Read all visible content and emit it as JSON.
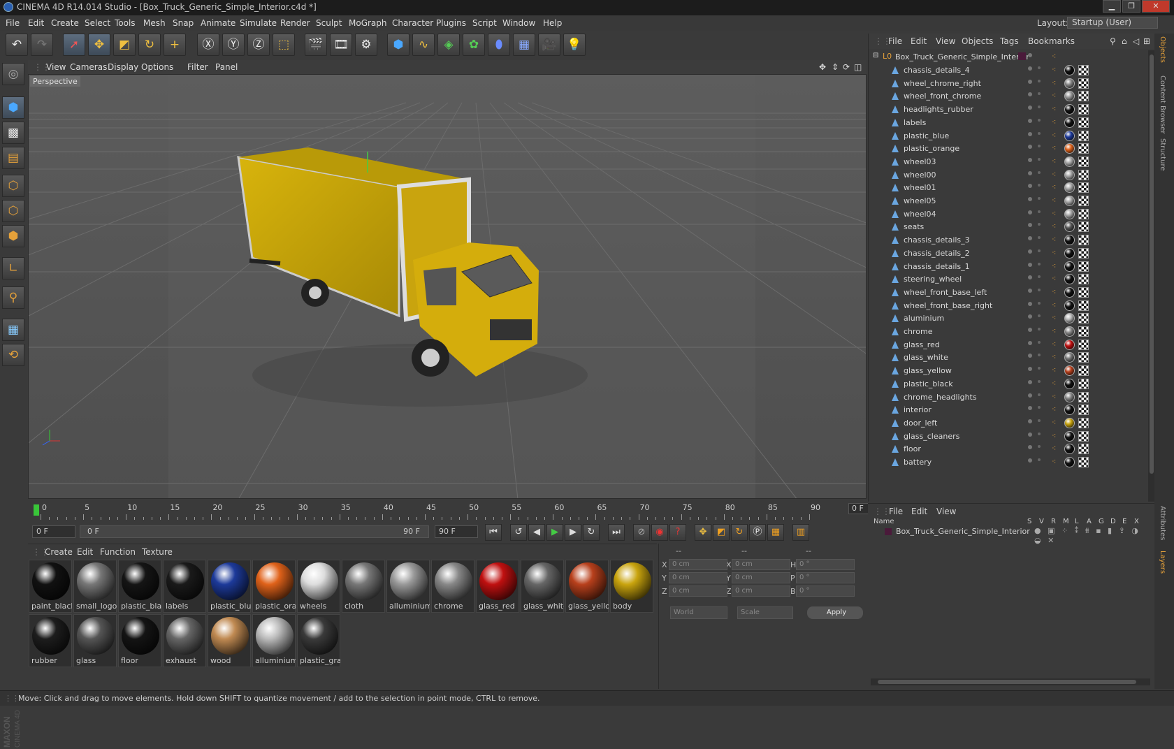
{
  "window": {
    "title": "CINEMA 4D R14.014 Studio - [Box_Truck_Generic_Simple_Interior.c4d *]",
    "minimize": "▁",
    "maximize": "❐",
    "close": "✕"
  },
  "menu": [
    "File",
    "Edit",
    "Create",
    "Select",
    "Tools",
    "Mesh",
    "Snap",
    "Animate",
    "Simulate",
    "Render",
    "Sculpt",
    "MoGraph",
    "Character",
    "Plugins",
    "Script",
    "Window",
    "Help"
  ],
  "layout": {
    "label": "Layout:",
    "value": "Startup (User)"
  },
  "viewport": {
    "menu": [
      "View",
      "Cameras",
      "Display",
      "Options",
      "Filter",
      "Panel"
    ],
    "label": "Perspective"
  },
  "timeline": {
    "ticks": [
      "0",
      "5",
      "10",
      "15",
      "20",
      "25",
      "30",
      "35",
      "40",
      "45",
      "50",
      "55",
      "60",
      "65",
      "70",
      "75",
      "80",
      "85",
      "90"
    ],
    "current_frame": "0 F"
  },
  "anim": {
    "start": "0 F",
    "range_start": "0 F",
    "range_end": "90 F",
    "end": "90 F"
  },
  "materials": {
    "menu": [
      "Create",
      "Edit",
      "Function",
      "Texture"
    ],
    "items": [
      {
        "name": "paint_black",
        "color": "#111"
      },
      {
        "name": "small_logo",
        "color": "#777"
      },
      {
        "name": "plastic_black",
        "color": "#151515"
      },
      {
        "name": "labels",
        "color": "#1a1a1a"
      },
      {
        "name": "plastic_blue",
        "color": "#1d3a9a"
      },
      {
        "name": "plastic_orange",
        "color": "#e0621a"
      },
      {
        "name": "wheels",
        "color": "#ddd"
      },
      {
        "name": "cloth",
        "color": "#777"
      },
      {
        "name": "alluminium",
        "color": "#999"
      },
      {
        "name": "chrome",
        "color": "#888"
      },
      {
        "name": "glass_red",
        "color": "#c01010"
      },
      {
        "name": "glass_white",
        "color": "#666"
      },
      {
        "name": "glass_yellow",
        "color": "#b8401c"
      },
      {
        "name": "body",
        "color": "#c9a40e"
      },
      {
        "name": "rubber",
        "color": "#1d1d1d"
      },
      {
        "name": "glass",
        "color": "#555"
      },
      {
        "name": "floor",
        "color": "#141414"
      },
      {
        "name": "exhaust",
        "color": "#666"
      },
      {
        "name": "wood",
        "color": "#c08a52"
      },
      {
        "name": "alluminium",
        "color": "#bbb"
      },
      {
        "name": "plastic_gray",
        "color": "#3a3a3a"
      }
    ]
  },
  "attributes": {
    "headers": [
      "--",
      "--",
      "--"
    ],
    "rows": [
      {
        "a": "X",
        "v1": "0 cm",
        "b": "X",
        "v2": "0 cm",
        "c": "H",
        "v3": "0 °"
      },
      {
        "a": "Y",
        "v1": "0 cm",
        "b": "Y",
        "v2": "0 cm",
        "c": "P",
        "v3": "0 °"
      },
      {
        "a": "Z",
        "v1": "0 cm",
        "b": "Z",
        "v2": "0 cm",
        "c": "B",
        "v3": "0 °"
      }
    ],
    "space": "World",
    "mode": "Scale",
    "apply": "Apply"
  },
  "objects": {
    "menu": [
      "File",
      "Edit",
      "View",
      "Objects",
      "Tags",
      "Bookmarks"
    ],
    "root": "Box_Truck_Generic_Simple_Interior",
    "items": [
      {
        "name": "chassis_details_4",
        "mat": "#111"
      },
      {
        "name": "wheel_chrome_right",
        "mat": "#888"
      },
      {
        "name": "wheel_front_chrome",
        "mat": "#999"
      },
      {
        "name": "headlights_rubber",
        "mat": "#111"
      },
      {
        "name": "labels",
        "mat": "#111"
      },
      {
        "name": "plastic_blue",
        "mat": "#1d3a9a"
      },
      {
        "name": "plastic_orange",
        "mat": "#e0621a"
      },
      {
        "name": "wheel03",
        "mat": "#aaa"
      },
      {
        "name": "wheel00",
        "mat": "#aaa"
      },
      {
        "name": "wheel01",
        "mat": "#aaa"
      },
      {
        "name": "wheel05",
        "mat": "#aaa"
      },
      {
        "name": "wheel04",
        "mat": "#aaa"
      },
      {
        "name": "seats",
        "mat": "#555"
      },
      {
        "name": "chassis_details_3",
        "mat": "#111"
      },
      {
        "name": "chassis_details_2",
        "mat": "#111"
      },
      {
        "name": "chassis_details_1",
        "mat": "#111"
      },
      {
        "name": "steering_wheel",
        "mat": "#111"
      },
      {
        "name": "wheel_front_base_left",
        "mat": "#111"
      },
      {
        "name": "wheel_front_base_right",
        "mat": "#111"
      },
      {
        "name": "aluminium",
        "mat": "#bbb"
      },
      {
        "name": "chrome",
        "mat": "#888"
      },
      {
        "name": "glass_red",
        "mat": "#c01010"
      },
      {
        "name": "glass_white",
        "mat": "#777"
      },
      {
        "name": "glass_yellow",
        "mat": "#b8401c"
      },
      {
        "name": "plastic_black",
        "mat": "#111"
      },
      {
        "name": "chrome_headlights",
        "mat": "#888"
      },
      {
        "name": "interior",
        "mat": "#111"
      },
      {
        "name": "door_left",
        "mat": "#c9a40e"
      },
      {
        "name": "glass_cleaners",
        "mat": "#111"
      },
      {
        "name": "floor",
        "mat": "#111"
      },
      {
        "name": "battery",
        "mat": "#111"
      }
    ]
  },
  "layers": {
    "menu": [
      "File",
      "Edit",
      "View"
    ],
    "name_header": "Name",
    "cols": [
      "S",
      "V",
      "R",
      "M",
      "L",
      "A",
      "G",
      "D",
      "E",
      "X"
    ],
    "item": "Box_Truck_Generic_Simple_Interior"
  },
  "sidetabs": [
    "Objects",
    "Content Browser",
    "Structure",
    "Attributes",
    "Layers"
  ],
  "status": "Move: Click and drag to move elements. Hold down SHIFT to quantize movement / add to the selection in point mode, CTRL to remove."
}
